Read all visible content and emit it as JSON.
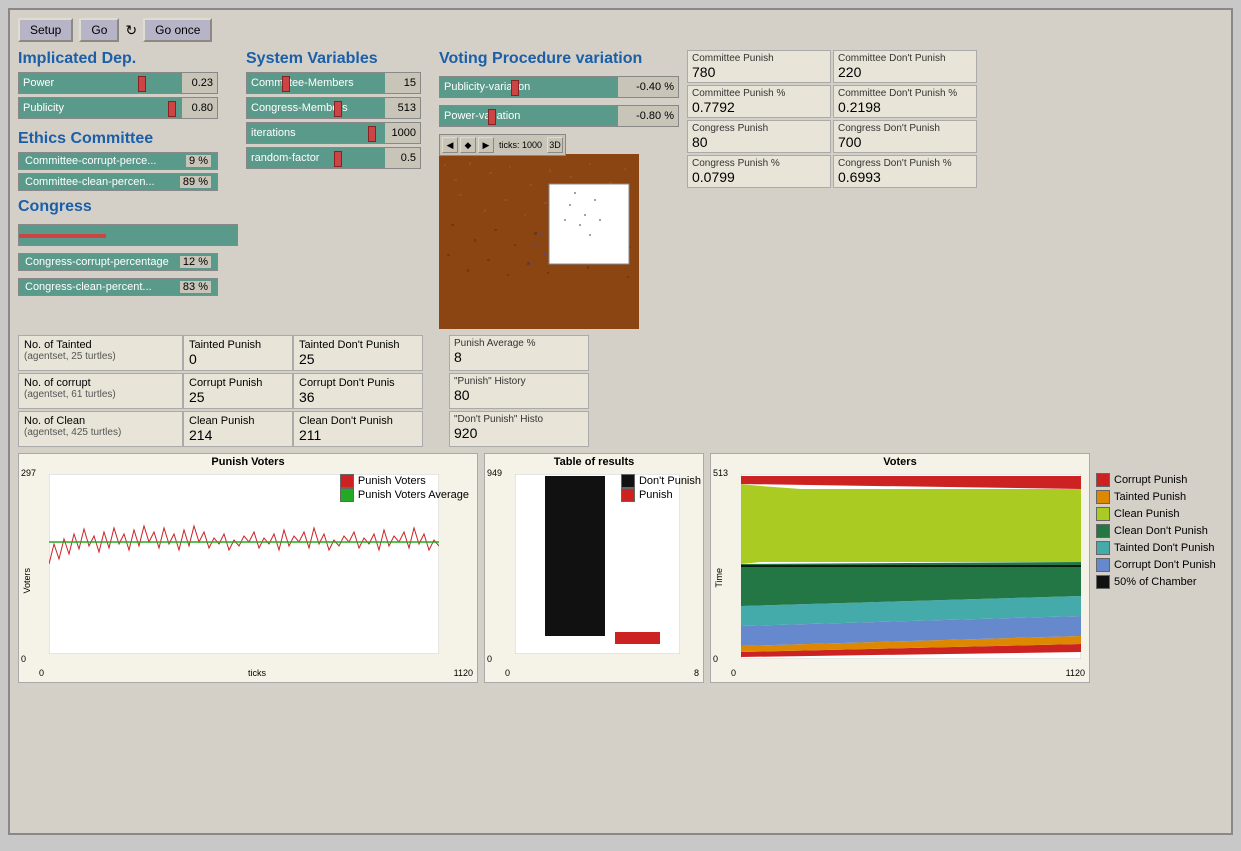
{
  "toolbar": {
    "setup_label": "Setup",
    "go_label": "Go",
    "go_once_label": "Go once"
  },
  "implicated_dep": {
    "title": "Implicated Dep.",
    "power": {
      "label": "Power",
      "value": "0.23"
    },
    "publicity": {
      "label": "Publicity",
      "value": "0.80"
    }
  },
  "ethics_committee": {
    "title": "Ethics Committee",
    "corrupt_perce": {
      "label": "Committee-corrupt-perce...",
      "value": "9 %"
    },
    "clean_percen": {
      "label": "Committee-clean-percen...",
      "value": "89 %"
    }
  },
  "system_variables": {
    "title": "System Variables",
    "committee_members": {
      "label": "Committee-Members",
      "value": "15"
    },
    "congress_members": {
      "label": "Congress-Members",
      "value": "513"
    },
    "iterations": {
      "label": "iterations",
      "value": "1000"
    },
    "random_factor": {
      "label": "random-factor",
      "value": "0.5"
    }
  },
  "voting_procedure": {
    "title": "Voting Procedure variation",
    "publicity_variation": {
      "label": "Publicity-variation",
      "value": "-0.40 %"
    },
    "power_variation": {
      "label": "Power-variation",
      "value": "-0.80 %"
    }
  },
  "map": {
    "ticks": "ticks: 1000",
    "btn_3d": "3D"
  },
  "stats": {
    "committee_punish": {
      "label": "Committee Punish",
      "value": "780"
    },
    "committee_dont_punish": {
      "label": "Committee Don't Punish",
      "value": "220"
    },
    "committee_punish_pct": {
      "label": "Committee Punish %",
      "value": "0.7792"
    },
    "committee_dont_punish_pct": {
      "label": "Committee Don't Punish %",
      "value": "0.2198"
    },
    "congress_punish": {
      "label": "Congress Punish",
      "value": "80"
    },
    "congress_dont_punish": {
      "label": "Congress Don't Punish",
      "value": "700"
    },
    "congress_punish_pct": {
      "label": "Congress Punish %",
      "value": "0.0799"
    },
    "congress_dont_punish_pct": {
      "label": "Congress Don't Punish %",
      "value": "0.6993"
    }
  },
  "congress": {
    "title": "Congress",
    "corrupt_pct": {
      "label": "Congress-corrupt-percentage",
      "value": "12 %"
    },
    "clean_pct": {
      "label": "Congress-clean-percent...",
      "value": "83 %"
    }
  },
  "data_table": {
    "rows": [
      {
        "label": "No. of Tainted",
        "sublabel": "(agentset, 25 turtles)",
        "col2_label": "Tainted Punish",
        "col2_value": "0",
        "col3_label": "Tainted Don't Punish",
        "col3_value": "25"
      },
      {
        "label": "No. of corrupt",
        "sublabel": "(agentset, 61 turtles)",
        "col2_label": "Corrupt Punish",
        "col2_value": "25",
        "col3_label": "Corrupt Don't Punis",
        "col3_value": "36"
      },
      {
        "label": "No. of Clean",
        "sublabel": "(agentset, 425 turtles)",
        "col2_label": "Clean Punish",
        "col2_value": "214",
        "col3_label": "Clean Don't Punish",
        "col3_value": "211"
      }
    ]
  },
  "punish_stats": {
    "avg_label": "Punish Average %",
    "avg_value": "8",
    "history_label": "\"Punish\" History",
    "history_value": "80",
    "dont_history_label": "\"Don't Punish\" Histo",
    "dont_history_value": "920"
  },
  "punish_voters_chart": {
    "title": "Punish Voters",
    "y_max": "297",
    "y_min": "0",
    "x_min": "0",
    "x_max": "1120",
    "x_label": "ticks",
    "y_label": "Voters",
    "legend": [
      {
        "label": "Punish Voters",
        "color": "#cc2222"
      },
      {
        "label": "Punish Voters Average",
        "color": "#22aa22"
      }
    ]
  },
  "results_chart": {
    "title": "Table of results",
    "y_max": "949",
    "y_min": "0",
    "x_min": "0",
    "x_max": "8",
    "legend": [
      {
        "label": "Don't Punish",
        "color": "#111111"
      },
      {
        "label": "Punish",
        "color": "#cc2222"
      }
    ]
  },
  "voters_chart": {
    "title": "Voters",
    "y_max": "513",
    "y_min": "0",
    "x_min": "0",
    "x_max": "1120",
    "y_label": "Time",
    "legend": [
      {
        "label": "Corrupt Punish",
        "color": "#cc2222"
      },
      {
        "label": "Tainted Punish",
        "color": "#dd8800"
      },
      {
        "label": "Clean Punish",
        "color": "#aacc22"
      },
      {
        "label": "Clean Don't Punish",
        "color": "#227744"
      },
      {
        "label": "Tainted Don't Punish",
        "color": "#44aaaa"
      },
      {
        "label": "Corrupt Don't Punish",
        "color": "#6688cc"
      },
      {
        "label": "50% of Chamber",
        "color": "#111111"
      }
    ]
  }
}
